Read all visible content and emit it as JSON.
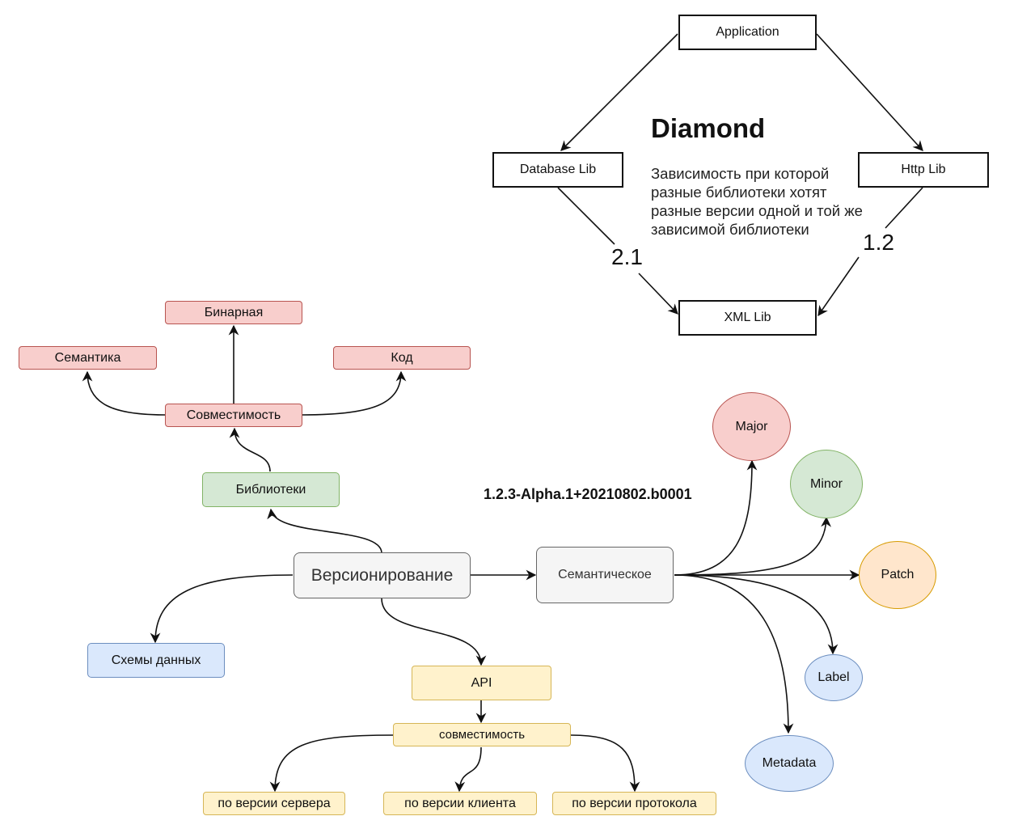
{
  "diamond": {
    "title": "Diamond",
    "description": "Зависимость при которой разные библиотеки хотят разные версии одной и той же зависимой библиотеки",
    "nodes": {
      "application": "Application",
      "database_lib": "Database Lib",
      "http_lib": "Http Lib",
      "xml_lib": "XML Lib"
    },
    "edge_labels": {
      "database_to_xml": "2.1",
      "http_to_xml": "1.2"
    }
  },
  "compatibility_tree": {
    "root": "Совместимость",
    "children": [
      "Семантика",
      "Бинарная",
      "Код"
    ]
  },
  "versioning": {
    "center": "Версионирование",
    "libraries": "Библиотеки",
    "data_schemas": "Схемы данных",
    "api": "API",
    "api_compat": "совместимость",
    "api_compat_children": [
      "по версии сервера",
      "по версии клиента",
      "по версии протокола"
    ],
    "semantic": "Семантическое",
    "semver_example": "1.2.3-Alpha.1+20210802.b0001",
    "semver_parts": [
      "Major",
      "Minor",
      "Patch",
      "Label",
      "Metadata"
    ]
  },
  "colors": {
    "red_fill": "#f8cecc",
    "green_fill": "#d5e8d4",
    "blue_fill": "#dae8fc",
    "yellow_fill": "#fff2cc",
    "orange_fill": "#ffe6cc",
    "gray_fill": "#f5f5f5"
  }
}
